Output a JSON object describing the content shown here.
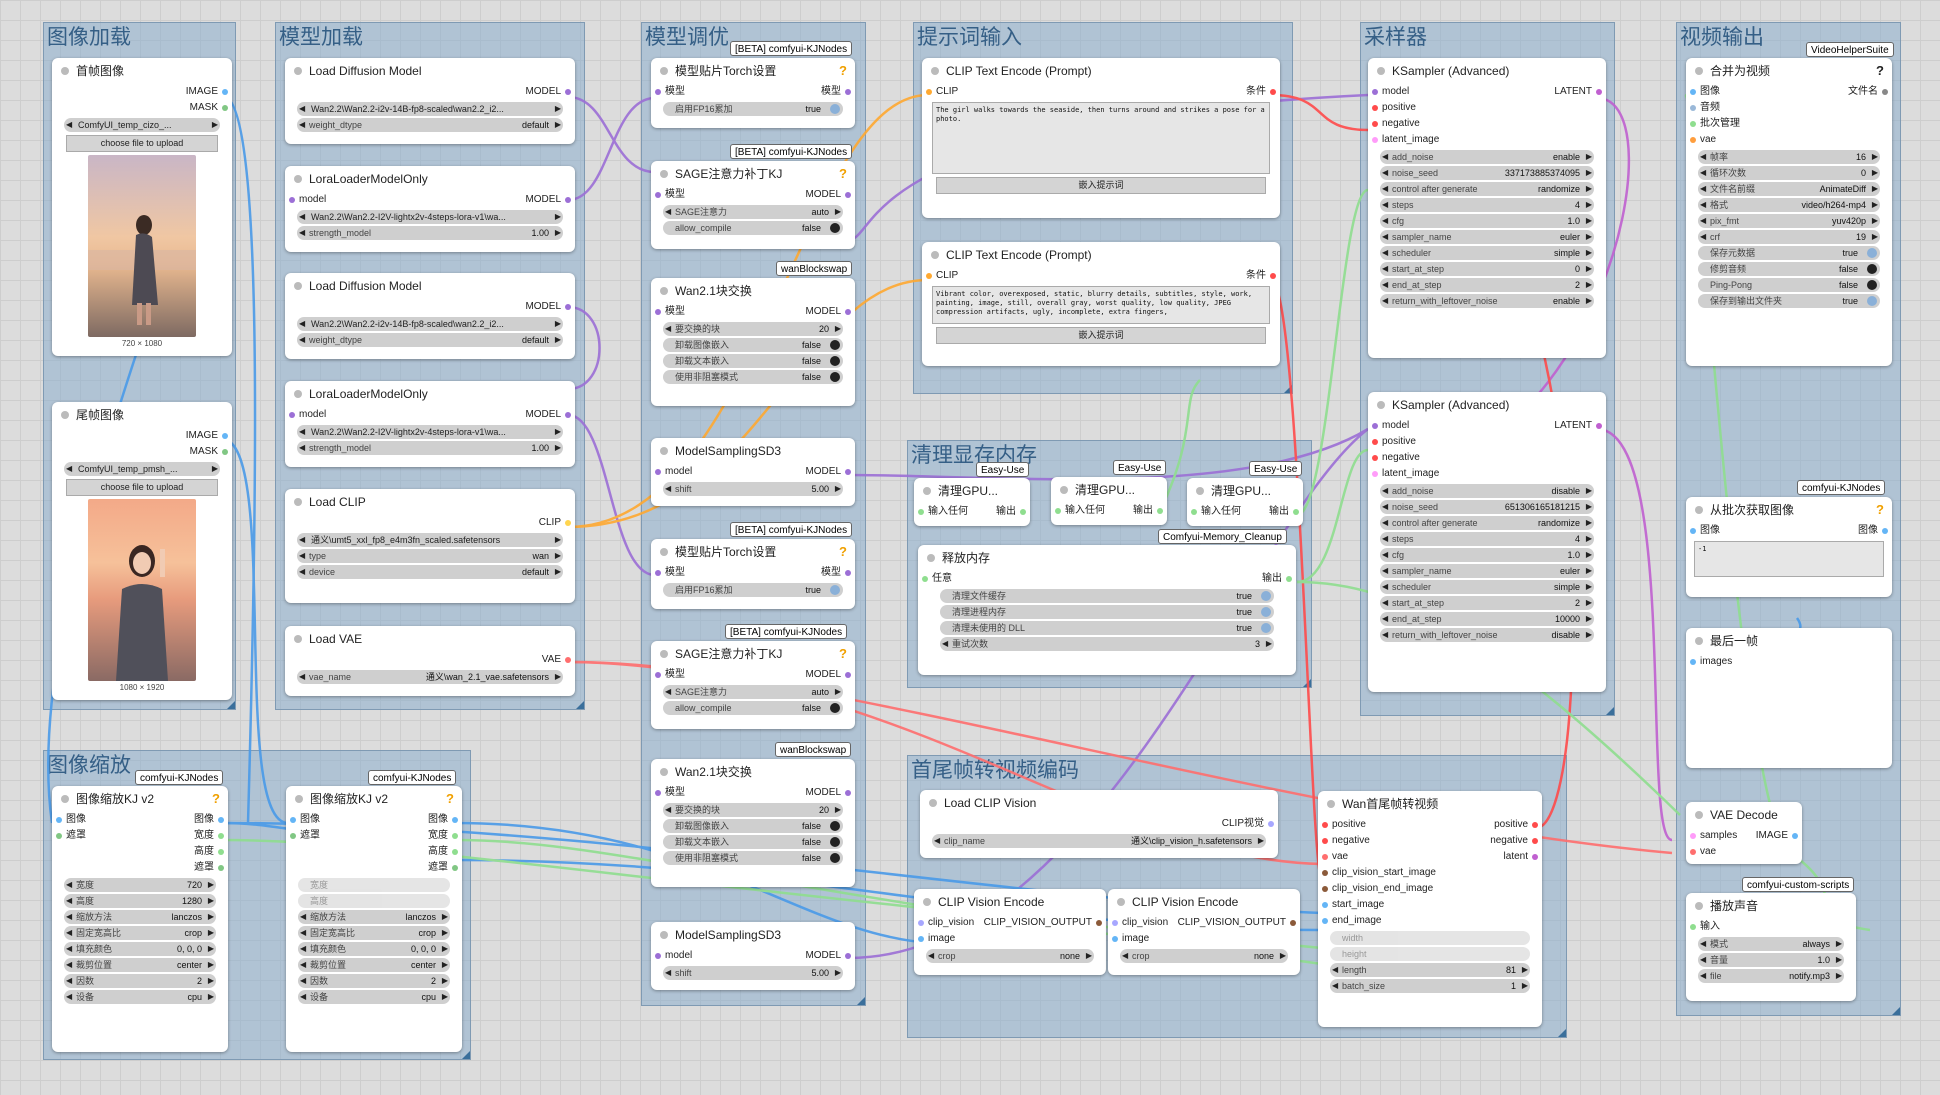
{
  "groups": {
    "img_load": "图像加载",
    "model_load": "模型加载",
    "model_tune": "模型调优",
    "prompt": "提示词输入",
    "sampler": "采样器",
    "video_out": "视频输出",
    "img_scale": "图像缩放",
    "clean_mem": "清理显存内存",
    "encode": "首尾帧转视频编码"
  },
  "badges": {
    "kj_beta": "[BETA] comfyui-KJNodes",
    "kj": "comfyui-KJNodes",
    "wanbs": "wanBlockswap",
    "vhs": "VideoHelperSuite",
    "easy": "Easy-Use",
    "memclean": "Comfyui-Memory_Cleanup",
    "scripts": "comfyui-custom-scripts"
  },
  "first_frame": {
    "title": "首帧图像",
    "out_image": "IMAGE",
    "out_mask": "MASK",
    "file": "ComfyUI_temp_cizo_...",
    "upload": "choose file to upload",
    "size": "720 × 1080"
  },
  "last_frame": {
    "title": "尾帧图像",
    "out_image": "IMAGE",
    "out_mask": "MASK",
    "file": "ComfyUI_temp_pmsh_...",
    "upload": "choose file to upload",
    "size": "1080 × 1920"
  },
  "load_diff1": {
    "title": "Load Diffusion Model",
    "out": "MODEL",
    "unet": "Wan2.2\\Wan2.2-i2v-14B-fp8-scaled\\wan2.2_i2...",
    "dtype_l": "weight_dtype",
    "dtype_v": "default"
  },
  "lora1": {
    "title": "LoraLoaderModelOnly",
    "in": "model",
    "out": "MODEL",
    "lora": "Wan2.2\\Wan2.2-I2V-lightx2v-4steps-lora-v1\\wa...",
    "str_l": "strength_model",
    "str_v": "1.00"
  },
  "load_diff2": {
    "title": "Load Diffusion Model",
    "out": "MODEL",
    "unet": "Wan2.2\\Wan2.2-i2v-14B-fp8-scaled\\wan2.2_i2...",
    "dtype_l": "weight_dtype",
    "dtype_v": "default"
  },
  "lora2": {
    "title": "LoraLoaderModelOnly",
    "in": "model",
    "out": "MODEL",
    "lora": "Wan2.2\\Wan2.2-I2V-lightx2v-4steps-lora-v1\\wa...",
    "str_l": "strength_model",
    "str_v": "1.00"
  },
  "load_clip": {
    "title": "Load CLIP",
    "out": "CLIP",
    "name": "通义\\umt5_xxl_fp8_e4m3fn_scaled.safetensors",
    "type_l": "type",
    "type_v": "wan",
    "dev_l": "device",
    "dev_v": "default"
  },
  "load_vae": {
    "title": "Load VAE",
    "out": "VAE",
    "l": "vae_name",
    "v": "通义\\wan_2.1_vae.safetensors"
  },
  "torch1": {
    "title": "模型贴片Torch设置",
    "in": "模型",
    "out": "模型",
    "w_l": "启用FP16累加",
    "w_v": "true"
  },
  "sage1": {
    "title": "SAGE注意力补丁KJ",
    "in": "模型",
    "out": "MODEL",
    "w1_l": "SAGE注意力",
    "w1_v": "auto",
    "w2_l": "allow_compile",
    "w2_v": "false"
  },
  "wan_bs1": {
    "title": "Wan2.1块交换",
    "in": "模型",
    "out": "MODEL",
    "b_l": "要交换的块",
    "b_v": "20",
    "c1_l": "卸载图像嵌入",
    "c1_v": "false",
    "c2_l": "卸载文本嵌入",
    "c2_v": "false",
    "c3_l": "使用非阻塞模式",
    "c3_v": "false"
  },
  "msd1": {
    "title": "ModelSamplingSD3",
    "in": "model",
    "out": "MODEL",
    "l": "shift",
    "v": "5.00"
  },
  "torch2": {
    "title": "模型贴片Torch设置",
    "in": "模型",
    "out": "模型",
    "w_l": "启用FP16累加",
    "w_v": "true"
  },
  "sage2": {
    "title": "SAGE注意力补丁KJ",
    "in": "模型",
    "out": "MODEL",
    "w1_l": "SAGE注意力",
    "w1_v": "auto",
    "w2_l": "allow_compile",
    "w2_v": "false"
  },
  "wan_bs2": {
    "title": "Wan2.1块交换",
    "in": "模型",
    "out": "MODEL",
    "b_l": "要交换的块",
    "b_v": "20",
    "c1_l": "卸载图像嵌入",
    "c1_v": "false",
    "c2_l": "卸载文本嵌入",
    "c2_v": "false",
    "c3_l": "使用非阻塞模式",
    "c3_v": "false"
  },
  "msd2": {
    "title": "ModelSamplingSD3",
    "in": "model",
    "out": "MODEL",
    "l": "shift",
    "v": "5.00"
  },
  "clip_pos": {
    "title": "CLIP Text Encode (Prompt)",
    "in": "CLIP",
    "out": "条件",
    "text": "The girl walks towards the seaside, then turns around and strikes a pose for a photo.",
    "btn": "嵌入提示词"
  },
  "clip_neg": {
    "title": "CLIP Text Encode (Prompt)",
    "in": "CLIP",
    "out": "条件",
    "text": "Vibrant color, overexposed, static, blurry details, subtitles, style, work, painting, image, still, overall gray, worst quality, low quality, JPEG compression artifacts, ugly, incomplete, extra fingers,",
    "btn": "嵌入提示词"
  },
  "ks1": {
    "title": "KSampler (Advanced)",
    "in": [
      "model",
      "positive",
      "negative",
      "latent_image"
    ],
    "out": "LATENT",
    "w": [
      [
        "add_noise",
        "enable"
      ],
      [
        "noise_seed",
        "337173885374095"
      ],
      [
        "control after generate",
        "randomize"
      ],
      [
        "steps",
        "4"
      ],
      [
        "cfg",
        "1.0"
      ],
      [
        "sampler_name",
        "euler"
      ],
      [
        "scheduler",
        "simple"
      ],
      [
        "start_at_step",
        "0"
      ],
      [
        "end_at_step",
        "2"
      ],
      [
        "return_with_leftover_noise",
        "enable"
      ]
    ]
  },
  "ks2": {
    "title": "KSampler (Advanced)",
    "in": [
      "model",
      "positive",
      "negative",
      "latent_image"
    ],
    "out": "LATENT",
    "w": [
      [
        "add_noise",
        "disable"
      ],
      [
        "noise_seed",
        "651306165181215"
      ],
      [
        "control after generate",
        "randomize"
      ],
      [
        "steps",
        "4"
      ],
      [
        "cfg",
        "1.0"
      ],
      [
        "sampler_name",
        "euler"
      ],
      [
        "scheduler",
        "simple"
      ],
      [
        "start_at_step",
        "2"
      ],
      [
        "end_at_step",
        "10000"
      ],
      [
        "return_with_leftover_noise",
        "disable"
      ]
    ]
  },
  "combine": {
    "title": "合并为视频",
    "in": [
      "图像",
      "音频",
      "批次管理",
      "vae"
    ],
    "out": "文件名",
    "w": [
      [
        "帧率",
        "16",
        "a"
      ],
      [
        "循环次数",
        "0",
        "a"
      ],
      [
        "文件名前缀",
        "AnimateDiff",
        "t"
      ],
      [
        "格式",
        "video/h264-mp4",
        "a"
      ],
      [
        "pix_fmt",
        "yuv420p",
        "a"
      ],
      [
        "crf",
        "19",
        "a"
      ],
      [
        "保存元数据",
        "true",
        "on"
      ],
      [
        "修剪音频",
        "false",
        "cb"
      ],
      [
        "Ping-Pong",
        "false",
        "cb"
      ],
      [
        "保存到输出文件夹",
        "true",
        "on"
      ]
    ]
  },
  "batch_get": {
    "title": "从批次获取图像",
    "in": "图像",
    "out": "图像",
    "val": "-1"
  },
  "last_one": {
    "title": "最后一帧",
    "in": "images"
  },
  "vae_dec": {
    "title": "VAE Decode",
    "in1": "samples",
    "in2": "vae",
    "out": "IMAGE"
  },
  "play_sound": {
    "title": "播放声音",
    "in": "输入",
    "w": [
      [
        "模式",
        "always"
      ],
      [
        "音量",
        "1.0"
      ],
      [
        "file",
        "notify.mp3"
      ]
    ]
  },
  "scale1": {
    "title": "图像缩放KJ v2",
    "in1": "图像",
    "in2": "遮罩",
    "outs": [
      "图像",
      "宽度",
      "高度",
      "遮罩"
    ],
    "w": [
      [
        "宽度",
        "720"
      ],
      [
        "高度",
        "1280"
      ],
      [
        "缩放方法",
        "lanczos"
      ],
      [
        "固定宽高比",
        "crop"
      ],
      [
        "填充颜色",
        "0, 0, 0"
      ],
      [
        "裁剪位置",
        "center"
      ],
      [
        "因数",
        "2"
      ],
      [
        "设备",
        "cpu"
      ]
    ]
  },
  "scale2": {
    "title": "图像缩放KJ v2",
    "in1": "图像",
    "in2": "遮罩",
    "outs": [
      "图像",
      "宽度",
      "高度",
      "遮罩"
    ],
    "dis": [
      "宽度",
      "高度"
    ],
    "w": [
      [
        "缩放方法",
        "lanczos"
      ],
      [
        "固定宽高比",
        "crop"
      ],
      [
        "填充颜色",
        "0, 0, 0"
      ],
      [
        "裁剪位置",
        "center"
      ],
      [
        "因数",
        "2"
      ],
      [
        "设备",
        "cpu"
      ]
    ]
  },
  "gpu": {
    "title": "清理GPU...",
    "in": "输入任何",
    "out": "输出"
  },
  "free_mem": {
    "title": "释放内存",
    "in": "任意",
    "out": "输出",
    "w": [
      [
        "清理文件缓存",
        "true",
        "on"
      ],
      [
        "清理进程内存",
        "true",
        "on"
      ],
      [
        "清理未使用的 DLL",
        "true",
        "on"
      ],
      [
        "重试次数",
        "3",
        "a"
      ]
    ]
  },
  "load_cv": {
    "title": "Load CLIP Vision",
    "out": "CLIP视觉",
    "l": "clip_name",
    "v": "通义\\clip_vision_h.safetensors"
  },
  "cve1": {
    "title": "CLIP Vision Encode",
    "in1": "clip_vision",
    "out": "CLIP_VISION_OUTPUT",
    "in2": "image",
    "l": "crop",
    "v": "none"
  },
  "cve2": {
    "title": "CLIP Vision Encode",
    "in1": "clip_vision",
    "out": "CLIP_VISION_OUTPUT",
    "in2": "image",
    "l": "crop",
    "v": "none"
  },
  "wan_fl": {
    "title": "Wan首尾帧转视频",
    "ins": [
      "positive",
      "negative",
      "vae",
      "clip_vision_start_image",
      "clip_vision_end_image",
      "start_image",
      "end_image"
    ],
    "outs": [
      "positive",
      "negative",
      "latent"
    ],
    "dis": [
      "width",
      "height"
    ],
    "w": [
      [
        "length",
        "81"
      ],
      [
        "batch_size",
        "1"
      ]
    ]
  },
  "colors": {
    "model": "#b39ddb",
    "clip": "#ffd54f",
    "vae": "#ff6e6e",
    "cond": "#ffa931",
    "latent": "#ff9cf9",
    "image": "#64b5f6",
    "mask": "#81c784",
    "any": "#8fde8f",
    "int": "#9eda7e"
  }
}
